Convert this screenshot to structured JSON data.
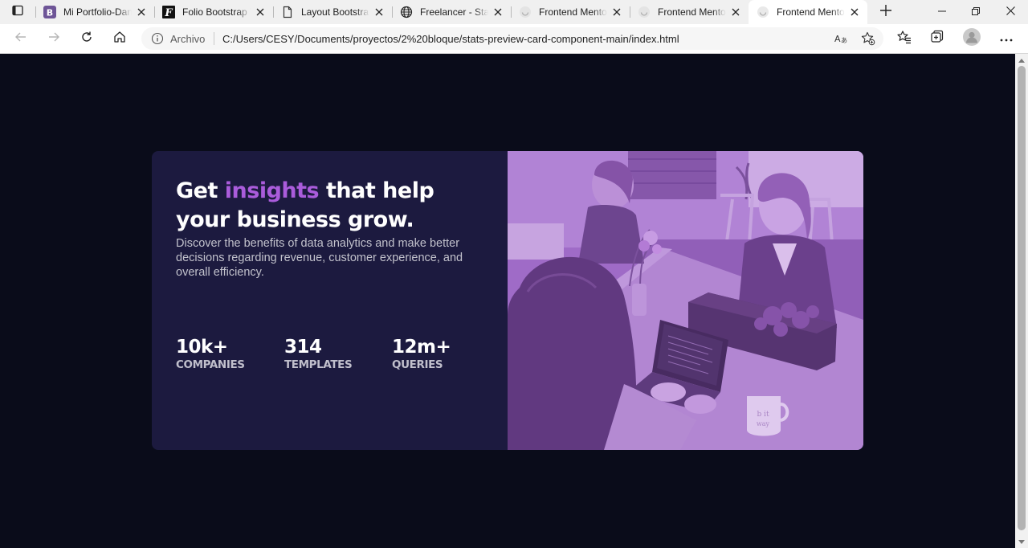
{
  "browser": {
    "tabs": [
      {
        "title": "Mi Portfolio-Daniel",
        "favicon": "bootstrap-b-icon",
        "active": false
      },
      {
        "title": "Folio Bootstrap Template",
        "favicon": "folio-f-icon",
        "active": false
      },
      {
        "title": "Layout Bootstrap",
        "favicon": "document-icon",
        "active": false
      },
      {
        "title": "Freelancer - Start Bootstrap",
        "favicon": "globe-icon",
        "active": false
      },
      {
        "title": "Frontend Mentor",
        "favicon": "loading-spinner-icon",
        "active": false
      },
      {
        "title": "Frontend Mentor",
        "favicon": "loading-spinner-icon",
        "active": false
      },
      {
        "title": "Frontend Mentor",
        "favicon": "loading-spinner-icon",
        "active": true
      }
    ],
    "address_bar": {
      "security_label": "Archivo",
      "url": "C:/Users/CESY/Documents/proyectos/2%20bloque/stats-preview-card-component-main/index.html"
    }
  },
  "card": {
    "headline_start": "Get ",
    "headline_accent": "insights",
    "headline_end": " that help your business grow.",
    "description": "Discover the benefits of data analytics and make better decisions regarding revenue, customer experience, and overall efficiency.",
    "stats": [
      {
        "value": "10k+",
        "label": "COMPANIES"
      },
      {
        "value": "314",
        "label": "TEMPLATES"
      },
      {
        "value": "12m+",
        "label": "QUERIES"
      }
    ]
  },
  "colors": {
    "page_background": "#0a0c1a",
    "card_background": "#1c1a3f",
    "accent": "#aa5cdb",
    "image_overlay": "#a86fd0"
  }
}
